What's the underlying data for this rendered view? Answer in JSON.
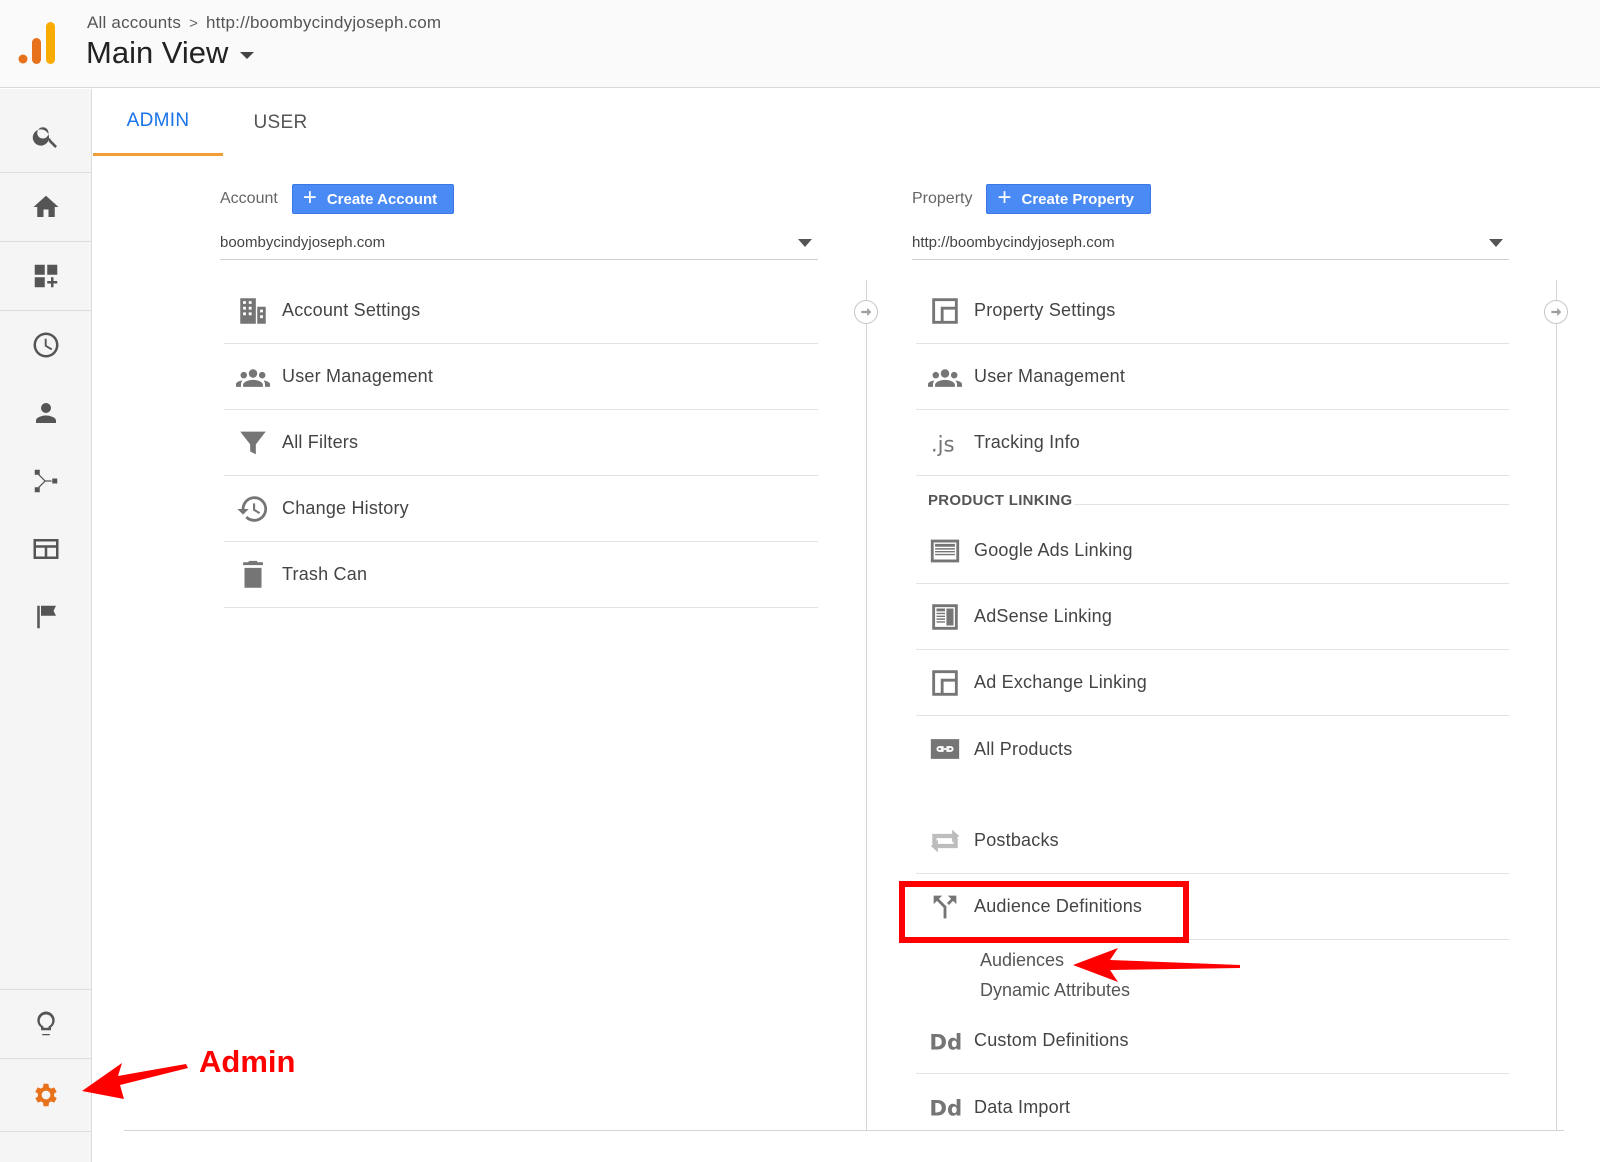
{
  "header": {
    "breadcrumb_all": "All accounts",
    "breadcrumb_separator": ">",
    "breadcrumb_property": "http://boombycindyjoseph.com",
    "view_title": "Main View"
  },
  "tabs": [
    {
      "label": "ADMIN",
      "active": true
    },
    {
      "label": "USER",
      "active": false
    }
  ],
  "account": {
    "label": "Account",
    "create_label": "Create Account",
    "selected": "boombycindyjoseph.com",
    "items": [
      {
        "label": "Account Settings",
        "icon": "building-icon"
      },
      {
        "label": "User Management",
        "icon": "people-icon"
      },
      {
        "label": "All Filters",
        "icon": "filter-icon"
      },
      {
        "label": "Change History",
        "icon": "history-icon"
      },
      {
        "label": "Trash Can",
        "icon": "trash-icon"
      }
    ]
  },
  "property": {
    "label": "Property",
    "create_label": "Create Property",
    "selected": "http://boombycindyjoseph.com",
    "items": [
      {
        "label": "Property Settings",
        "icon": "window-icon"
      },
      {
        "label": "User Management",
        "icon": "people-icon"
      },
      {
        "label": "Tracking Info",
        "icon": "js-icon"
      }
    ],
    "section_label": "PRODUCT LINKING",
    "linking_items": [
      {
        "label": "Google Ads Linking",
        "icon": "ads-icon"
      },
      {
        "label": "AdSense Linking",
        "icon": "adsense-icon"
      },
      {
        "label": "Ad Exchange Linking",
        "icon": "window-icon"
      },
      {
        "label": "All Products",
        "icon": "link-icon"
      }
    ],
    "more_items": [
      {
        "label": "Postbacks",
        "icon": "postbacks-icon"
      },
      {
        "label": "Audience Definitions",
        "icon": "audience-icon"
      }
    ],
    "sub_items": [
      "Audiences",
      "Dynamic Attributes"
    ],
    "bottom_items": [
      {
        "label": "Custom Definitions",
        "icon": "dd-icon"
      },
      {
        "label": "Data Import",
        "icon": "dd-icon"
      }
    ]
  },
  "annotation": {
    "label": "Admin",
    "color": "#ff0000"
  },
  "colors": {
    "accent_blue": "#1a73e8",
    "button_blue": "#4a8af4",
    "tab_underline": "#f29d38",
    "admin_gear": "#e8711c"
  }
}
